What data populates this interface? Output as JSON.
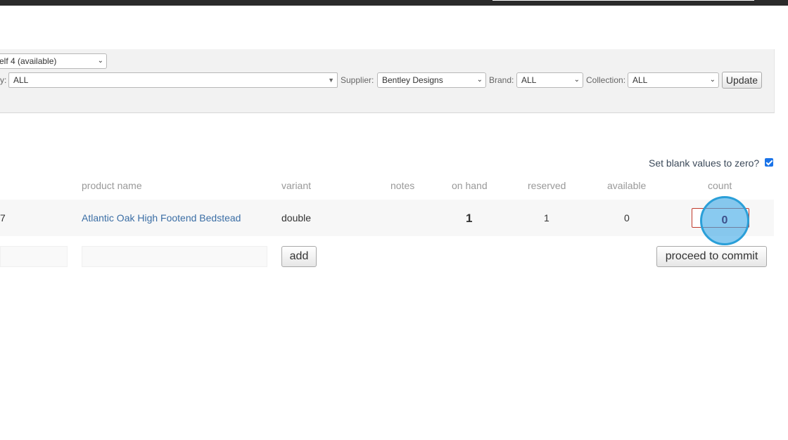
{
  "filters": {
    "location_value": "elf 4 (available)",
    "category_label": "y:",
    "category_value": "ALL",
    "supplier_label": "Supplier:",
    "supplier_value": "Bentley Designs",
    "brand_label": "Brand:",
    "brand_value": "ALL",
    "collection_label": "Collection:",
    "collection_value": "ALL",
    "update_label": "Update"
  },
  "options": {
    "blank_to_zero_label": "Set blank values to zero?",
    "blank_to_zero_checked": true
  },
  "table": {
    "columns": [
      "product name",
      "variant",
      "notes",
      "on hand",
      "reserved",
      "available",
      "count"
    ],
    "rows": [
      {
        "id_fragment": "7",
        "product_name": "Atlantic Oak High Footend Bedstead",
        "variant": "double",
        "notes": "",
        "on_hand": "1",
        "reserved": "1",
        "available": "0",
        "count": "0"
      }
    ]
  },
  "actions": {
    "add_label": "add",
    "commit_label": "proceed to commit"
  },
  "colors": {
    "link": "#3b6ea5",
    "invalid_border": "#c0392b",
    "click_highlight": "#2a9fd8",
    "checkbox": "#1a73e8"
  }
}
